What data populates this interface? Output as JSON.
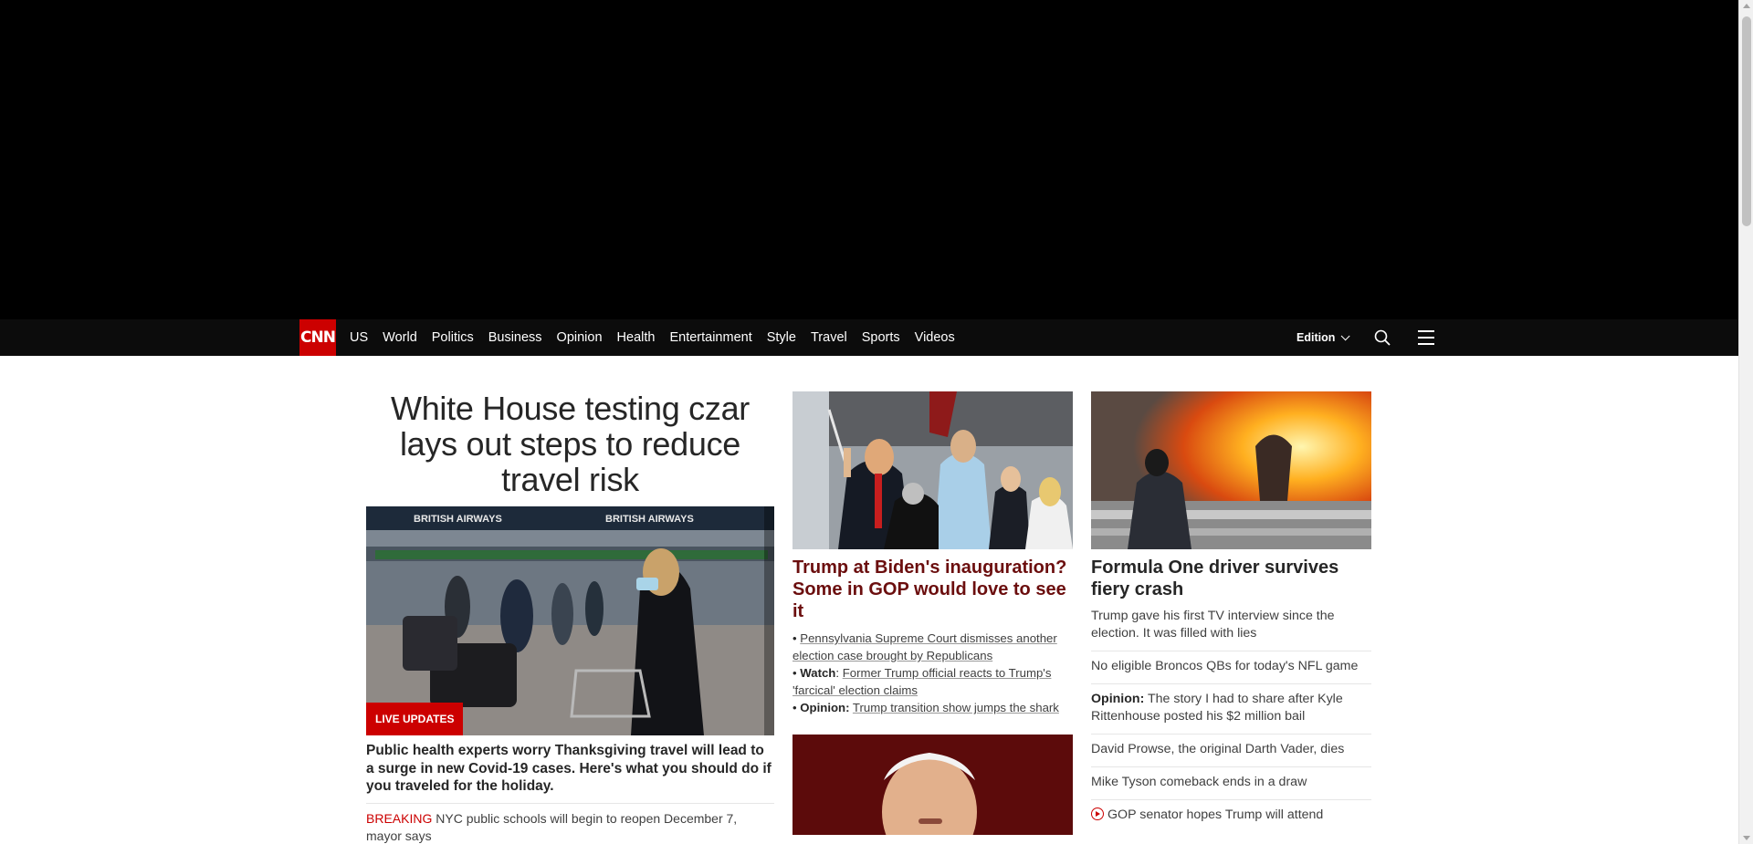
{
  "nav": {
    "logo": "CNN",
    "items": [
      "US",
      "World",
      "Politics",
      "Business",
      "Opinion",
      "Health",
      "Entertainment",
      "Style",
      "Travel",
      "Sports",
      "Videos"
    ],
    "edition": "Edition"
  },
  "lead": {
    "title": "White House testing czar lays out steps to reduce travel risk",
    "image_caption_icon": "airport-photo",
    "badge": "LIVE UPDATES",
    "subheadline": "Public health experts worry Thanksgiving travel will lead to a surge in new Covid-19 cases. Here's what you should do if you traveled for the holiday.",
    "breaking_tag": "BREAKING",
    "breaking_text": "NYC public schools will begin to reopen December 7, mayor says"
  },
  "center": {
    "title": "Trump at Biden's inauguration? Some in GOP would love to see it",
    "bullets": [
      {
        "prefix": "",
        "text": "Pennsylvania Supreme Court dismisses another election case brought by Republicans"
      },
      {
        "prefix": "Watch",
        "text": "Former Trump official reacts to Trump's 'farcical' election claims"
      },
      {
        "prefix": "Opinion:",
        "text": "Trump transition show jumps the shark"
      }
    ]
  },
  "right": {
    "title": "Formula One driver survives fiery crash",
    "items": [
      {
        "prefix": "",
        "text": "Trump gave his first TV interview since the election. It was filled with lies"
      },
      {
        "prefix": "",
        "text": "No eligible Broncos QBs for today's NFL game"
      },
      {
        "prefix": "Opinion:",
        "text": "The story I had to share after Kyle Rittenhouse posted his $2 million bail"
      },
      {
        "prefix": "",
        "text": "David Prowse, the original Darth Vader, dies"
      },
      {
        "prefix": "",
        "text": "Mike Tyson comeback ends in a draw"
      },
      {
        "prefix": "",
        "text": "GOP senator hopes Trump will attend"
      }
    ]
  },
  "colors": {
    "brand_red": "#cc0000",
    "nav_bg": "#0c0c0c",
    "headline_maroon": "#6b0e0e"
  }
}
